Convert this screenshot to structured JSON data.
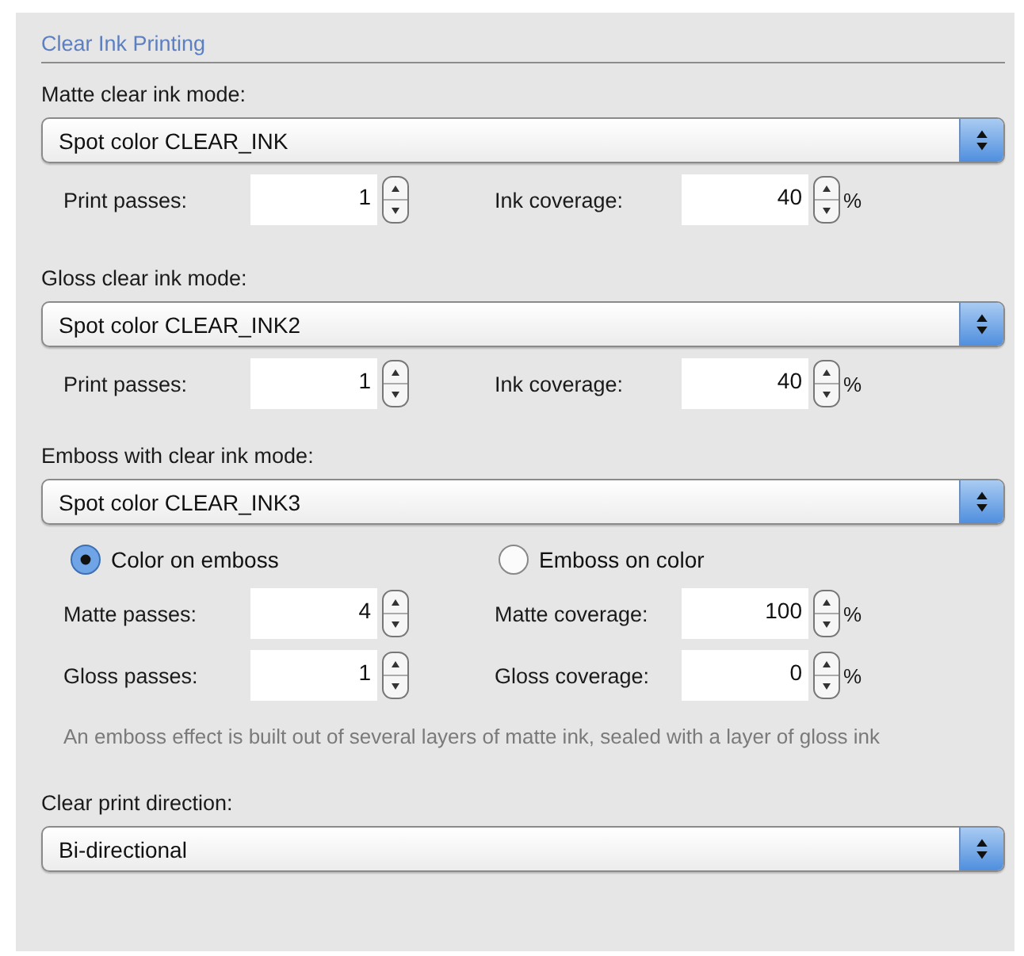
{
  "title": "Clear Ink Printing",
  "groups": [
    {
      "label": "Matte clear ink mode:",
      "select": "Spot color CLEAR_INK",
      "rows": [
        [
          {
            "label": "Print passes:",
            "value": "1"
          },
          {
            "label": "Ink coverage:",
            "value": "40",
            "unit": "%"
          }
        ]
      ]
    },
    {
      "label": "Gloss clear ink mode:",
      "select": "Spot color CLEAR_INK2",
      "rows": [
        [
          {
            "label": "Print passes:",
            "value": "1"
          },
          {
            "label": "Ink coverage:",
            "value": "40",
            "unit": "%"
          }
        ]
      ]
    },
    {
      "label": "Emboss with clear ink mode:",
      "select": "Spot color CLEAR_INK3",
      "radios": [
        {
          "label": "Color on emboss",
          "selected": true
        },
        {
          "label": "Emboss on color",
          "selected": false
        }
      ],
      "rows": [
        [
          {
            "label": "Matte passes:",
            "value": "4"
          },
          {
            "label": "Matte coverage:",
            "value": "100",
            "unit": "%"
          }
        ],
        [
          {
            "label": "Gloss passes:",
            "value": "1"
          },
          {
            "label": "Gloss coverage:",
            "value": "0",
            "unit": "%"
          }
        ]
      ],
      "note": "An emboss effect is built out of several layers of matte ink, sealed with a layer of gloss ink"
    },
    {
      "label": "Clear print direction:",
      "select": "Bi-directional"
    }
  ]
}
